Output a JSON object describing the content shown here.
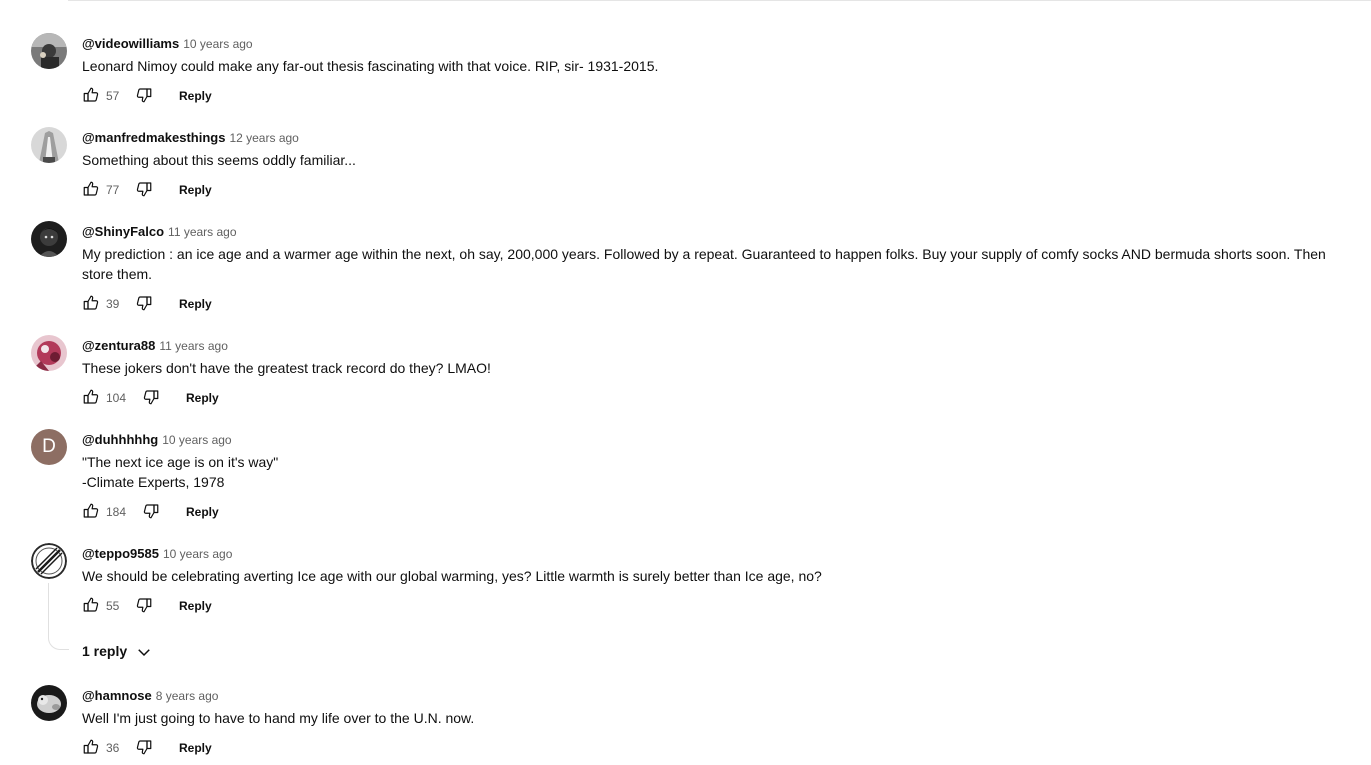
{
  "comments": [
    {
      "author": "@videowilliams",
      "time": "10 years ago",
      "text": "Leonard Nimoy could make any far-out thesis fascinating with that voice. RIP, sir- 1931-2015.",
      "likes": "57",
      "reply": "Reply",
      "avatar": "photo-avatar"
    },
    {
      "author": "@manfredmakesthings",
      "time": "12 years ago",
      "text": "Something about this seems oddly familiar...",
      "likes": "77",
      "reply": "Reply",
      "avatar": "photo-avatar"
    },
    {
      "author": "@ShinyFalco",
      "time": "11 years ago",
      "text": "My prediction : an ice age and a warmer age within the next, oh say, 200,000 years. Followed by a repeat. Guaranteed to happen folks. Buy your supply of comfy socks AND bermuda shorts soon. Then store them.",
      "likes": "39",
      "reply": "Reply",
      "avatar": "photo-avatar"
    },
    {
      "author": "@zentura88",
      "time": "11 years ago",
      "text": "These jokers don't have the greatest track record do they?  LMAO!",
      "likes": "104",
      "reply": "Reply",
      "avatar": "photo-avatar"
    },
    {
      "author": "@duhhhhhg",
      "time": "10 years ago",
      "text": "\"The next ice age is on it's way\"\n-Climate Experts, 1978",
      "likes": "184",
      "reply": "Reply",
      "avatar": "letter-avatar",
      "avatar_letter": "D",
      "avatar_color": "#8d6e63"
    },
    {
      "author": "@teppo9585",
      "time": "10 years ago",
      "text": "We should be celebrating averting Ice age with our global warming, yes? Little warmth is surely better than Ice age, no?",
      "likes": "55",
      "reply": "Reply",
      "avatar": "no-entry-avatar",
      "replies_label": "1 reply"
    },
    {
      "author": "@hamnose",
      "time": "8 years ago",
      "text": "Well I'm just going to have to hand my life over to the U.N. now.",
      "likes": "36",
      "reply": "Reply",
      "avatar": "photo-avatar"
    }
  ],
  "icons": {
    "like": "thumb-up-icon",
    "dislike": "thumb-down-icon",
    "expand": "chevron-down-icon"
  }
}
